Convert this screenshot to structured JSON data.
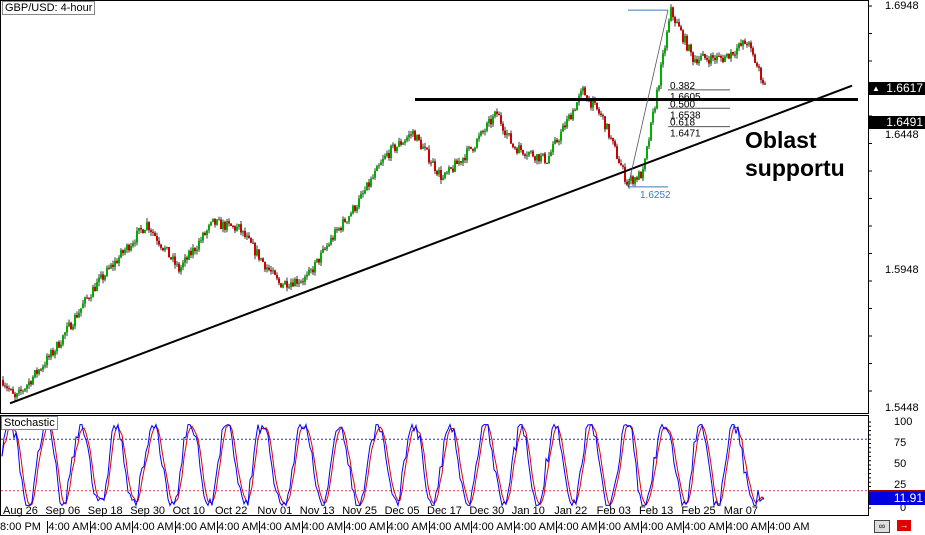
{
  "chart_title": "GBP/USD: 4-hour",
  "indicator_title": "Stochastic",
  "annotation": [
    "Oblast",
    "supportu"
  ],
  "colors": {
    "bull": "#00b000",
    "bear": "#d40000",
    "stoch_main": "#0000ff",
    "stoch_signal": "#e00000",
    "level_high": "#3030c0",
    "level_low": "#e04040"
  },
  "chart_data": {
    "type": "candlestick",
    "price_axis": {
      "ticks": [
        "1.6948",
        "1.6448",
        "1.5948",
        "1.5448"
      ],
      "range": [
        1.5448,
        1.6948
      ]
    },
    "price_tags": {
      "current": "1.6617",
      "line": "1.6491"
    },
    "current_triangle": "▲",
    "date_labels": [
      "Aug 26",
      "Sep 06",
      "Sep 18",
      "Sep 30",
      "Oct 10",
      "Oct 22",
      "Nov 01",
      "Nov 13",
      "Nov 25",
      "Dec 05",
      "Dec 17",
      "Dec 30",
      "Jan 10",
      "Jan 22",
      "Feb 03",
      "Feb 13",
      "Feb 25",
      "Mar 07"
    ],
    "time_labels": [
      "8:00 PM",
      "4:00 AM",
      "4:00 AM",
      "4:00 AM",
      "4:00 AM",
      "4:00 AM",
      "4:00 AM",
      "4:00 AM",
      "4:00 AM",
      "4:00 AM",
      "4:00 AM",
      "4:00 AM",
      "4:00 AM",
      "4:00 AM",
      "4:00 AM",
      "4:00 AM",
      "4:00 AM",
      "4:00 AM",
      "4:00 AM"
    ],
    "price_waypoints": [
      [
        0,
        1.555
      ],
      [
        6,
        1.548
      ],
      [
        25,
        1.565
      ],
      [
        45,
        1.588
      ],
      [
        72,
        1.612
      ],
      [
        88,
        1.595
      ],
      [
        105,
        1.612
      ],
      [
        118,
        1.61
      ],
      [
        138,
        1.59
      ],
      [
        152,
        1.592
      ],
      [
        165,
        1.607
      ],
      [
        178,
        1.62
      ],
      [
        192,
        1.637
      ],
      [
        205,
        1.645
      ],
      [
        220,
        1.628
      ],
      [
        235,
        1.64
      ],
      [
        247,
        1.652
      ],
      [
        255,
        1.64
      ],
      [
        272,
        1.635
      ],
      [
        290,
        1.66
      ],
      [
        300,
        1.65
      ],
      [
        312,
        1.627
      ],
      [
        320,
        1.63
      ],
      [
        334,
        1.689
      ],
      [
        345,
        1.672
      ],
      [
        360,
        1.672
      ],
      [
        372,
        1.678
      ],
      [
        381,
        1.662
      ]
    ],
    "resistance_level": 1.657,
    "trendline": [
      [
        0,
        1.5465
      ],
      [
        425,
        1.662
      ]
    ],
    "fibonacci": {
      "high": 1.6895,
      "low": "1.6252",
      "levels": [
        {
          "ratio": "0.382",
          "price": "1.6605"
        },
        {
          "ratio": "0.500",
          "price": "1.6538"
        },
        {
          "ratio": "0.618",
          "price": "1.6471"
        }
      ]
    },
    "stochastic": {
      "axis": [
        "100",
        "75",
        "50",
        "25",
        "0"
      ],
      "levels": [
        80,
        20
      ],
      "last": "11.91"
    }
  }
}
